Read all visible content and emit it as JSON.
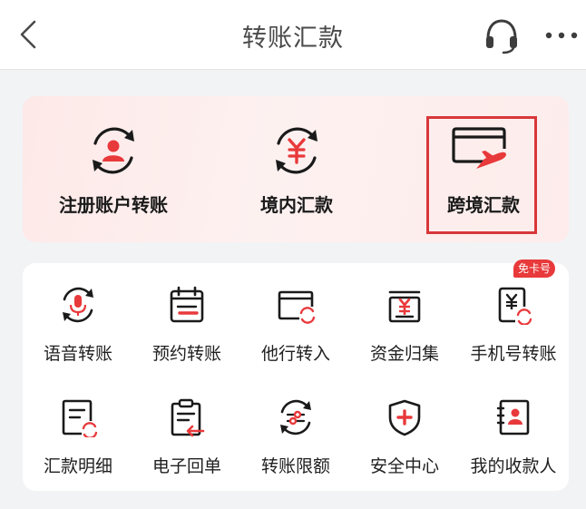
{
  "header": {
    "title": "转账汇款",
    "back_icon": "chevron-left-icon",
    "service_icon": "headset-icon",
    "more_icon": "more-dots-icon"
  },
  "primary_actions": [
    {
      "label": "注册账户转账",
      "icon": "registered-account-transfer-icon"
    },
    {
      "label": "境内汇款",
      "icon": "domestic-remittance-icon"
    },
    {
      "label": "跨境汇款",
      "icon": "cross-border-remittance-icon"
    }
  ],
  "services": [
    {
      "label": "语音转账",
      "icon": "voice-transfer-icon"
    },
    {
      "label": "预约转账",
      "icon": "scheduled-transfer-icon"
    },
    {
      "label": "他行转入",
      "icon": "other-bank-transfer-in-icon"
    },
    {
      "label": "资金归集",
      "icon": "fund-collection-icon"
    },
    {
      "label": "手机号转账",
      "icon": "phone-number-transfer-icon",
      "badge": "免卡号"
    },
    {
      "label": "汇款明细",
      "icon": "remittance-details-icon"
    },
    {
      "label": "电子回单",
      "icon": "electronic-receipt-icon"
    },
    {
      "label": "转账限额",
      "icon": "transfer-limit-icon"
    },
    {
      "label": "安全中心",
      "icon": "security-center-icon"
    },
    {
      "label": "我的收款人",
      "icon": "my-payees-icon"
    }
  ],
  "colors": {
    "accent": "#e8393b",
    "highlight": "#d8373a",
    "card_tint": "#fdeceb",
    "text": "#1a1a1a",
    "title_text": "#4a4a4a"
  }
}
